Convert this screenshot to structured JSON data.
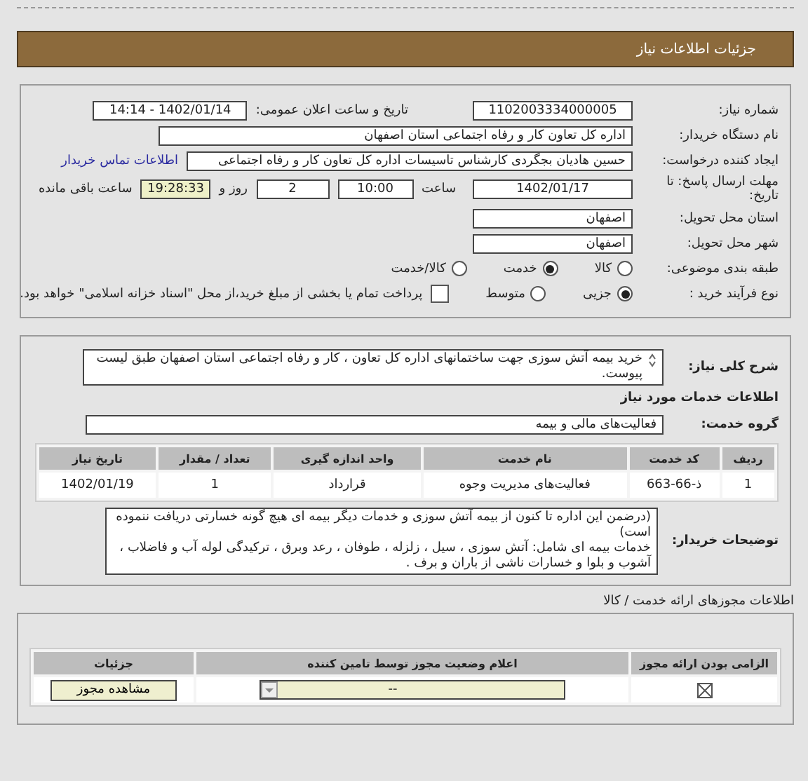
{
  "header": {
    "title": "جزئیات اطلاعات نیاز"
  },
  "need_number": {
    "label": "شماره نیاز:",
    "value": "1102003334000005"
  },
  "announce_datetime": {
    "label": "تاریخ و ساعت اعلان عمومی:",
    "value": "1402/01/14 - 14:14"
  },
  "buyer_org": {
    "label": "نام دستگاه خریدار:",
    "value": "اداره کل تعاون  کار و رفاه اجتماعی استان اصفهان"
  },
  "requester": {
    "label": "ایجاد کننده درخواست:",
    "value": "حسین هادیان بجگردی کارشناس تاسیسات اداره کل تعاون  کار و رفاه اجتماعی",
    "link": "اطلاعات تماس خریدار"
  },
  "deadline": {
    "label": "مهلت ارسال پاسخ: تا تاریخ:",
    "date": "1402/01/17",
    "time_label": "ساعت",
    "time": "10:00",
    "days": "2",
    "days_label": "روز و",
    "remaining": "19:28:33",
    "remaining_label": "ساعت باقی مانده"
  },
  "province": {
    "label": "استان محل تحویل:",
    "value": "اصفهان"
  },
  "city": {
    "label": "شهر محل تحویل:",
    "value": "اصفهان"
  },
  "category": {
    "label": "طبقه بندی موضوعی:",
    "options": [
      {
        "label": "کالا",
        "selected": false
      },
      {
        "label": "خدمت",
        "selected": true
      },
      {
        "label": "کالا/خدمت",
        "selected": false
      }
    ]
  },
  "purchase_process": {
    "label": "نوع فرآیند خرید :",
    "options": [
      {
        "label": "جزیی",
        "selected": true
      },
      {
        "label": "متوسط",
        "selected": false
      }
    ],
    "payment": {
      "checked": false,
      "text": "پرداخت تمام یا بخشی از مبلغ خرید،از محل \"اسناد خزانه اسلامی\" خواهد بود."
    }
  },
  "description": {
    "label": "شرح کلی نیاز:",
    "value": "خرید بیمه آتش سوزی جهت ساختمانهای اداره کل تعاون ، کار و رفاه اجتماعی استان اصفهان طبق لیست پیوست."
  },
  "services_title": "اطلاعات خدمات مورد نیاز",
  "service_group": {
    "label": "گروه خدمت:",
    "value": "فعالیت‌های مالی و بیمه"
  },
  "services_table": {
    "columns": [
      "ردیف",
      "کد خدمت",
      "نام خدمت",
      "واحد اندازه گیری",
      "تعداد / مقدار",
      "تاریخ نیاز"
    ],
    "rows": [
      [
        "1",
        "ذ-66-663",
        "فعالیت‌های مدیریت وجوه",
        "قرارداد",
        "1",
        "1402/01/19"
      ]
    ]
  },
  "buyer_notes": {
    "label": "توضیحات خریدار:",
    "paragraphs": [
      "(درضمن این اداره تا کنون از بیمه آتش سوزی و خدمات دیگر بیمه ای هیچ گونه خسارتی دریافت ننموده است)",
      "خدمات بیمه ای شامل: آتش سوزی ، سیل ، زلزله ، طوفان ، رعد وبرق ، ترکیدگی لوله آب و فاضلاب ، آشوب و بلوا و خسارات ناشی از باران و برف ."
    ]
  },
  "licenses_title": "اطلاعات مجوزهای ارائه خدمت / کالا",
  "license_table": {
    "columns": [
      "الزامی بودن ارائه مجوز",
      "اعلام وضعیت مجوز توسط تامین کننده",
      "جزئیات"
    ],
    "rows": [
      {
        "required": true,
        "status": "--",
        "details_button": "مشاهده مجوز"
      }
    ]
  }
}
